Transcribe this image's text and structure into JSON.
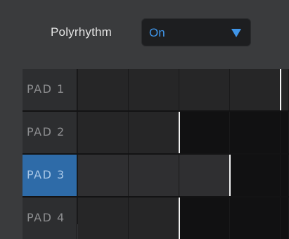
{
  "polyrhythm": {
    "label": "Polyrhythm",
    "value": "On",
    "accent_color": "#3f95e8"
  },
  "pads": [
    {
      "label": "PAD 1",
      "selected": false,
      "active_steps": 4
    },
    {
      "label": "PAD 2",
      "selected": false,
      "active_steps": 2
    },
    {
      "label": "PAD 3",
      "selected": true,
      "active_steps": 3
    },
    {
      "label": "PAD 4",
      "selected": false,
      "active_steps": 2
    }
  ],
  "colors": {
    "background": "#3a3b3d",
    "selected_pad": "#2e6ba8",
    "active_step": "#262627",
    "inactive_step": "#111112"
  },
  "icons": {
    "dropdown": "triangle-down-icon"
  }
}
